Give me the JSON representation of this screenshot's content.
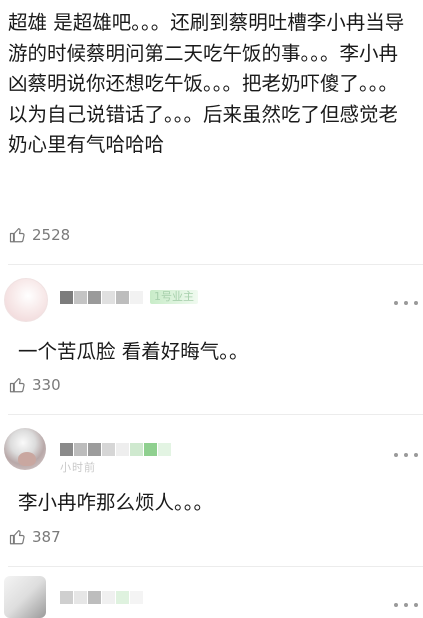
{
  "first_comment": {
    "text": "超雄 是超雄吧。。。还刷到蔡明吐槽李小冉当导游的时候蔡明问第二天吃午饭的事。。。李小冉凶蔡明说你还想吃午饭。。。把老奶吓傻了。。。以为自己说错话了。。。后来虽然吃了但感觉老奶心里有气哈哈哈",
    "likes": "2528"
  },
  "comments": [
    {
      "author_tag": "1号业主",
      "meta": "",
      "text": "一个苦瓜脸 看着好晦气。。",
      "likes": "330"
    },
    {
      "author_tag": "",
      "meta": "小时前",
      "text": "李小冉咋那么烦人。。。",
      "likes": "387"
    },
    {
      "author_tag": "",
      "meta": "",
      "text": "",
      "likes": ""
    }
  ],
  "icons": {
    "like": "thumbs-up-outline-icon",
    "more": "ellipsis-horizontal-icon"
  },
  "colors": {
    "text": "#1a1a1a",
    "muted": "#7a7a7a",
    "divider": "#ececec",
    "badge_green": "#c8ecc8"
  }
}
